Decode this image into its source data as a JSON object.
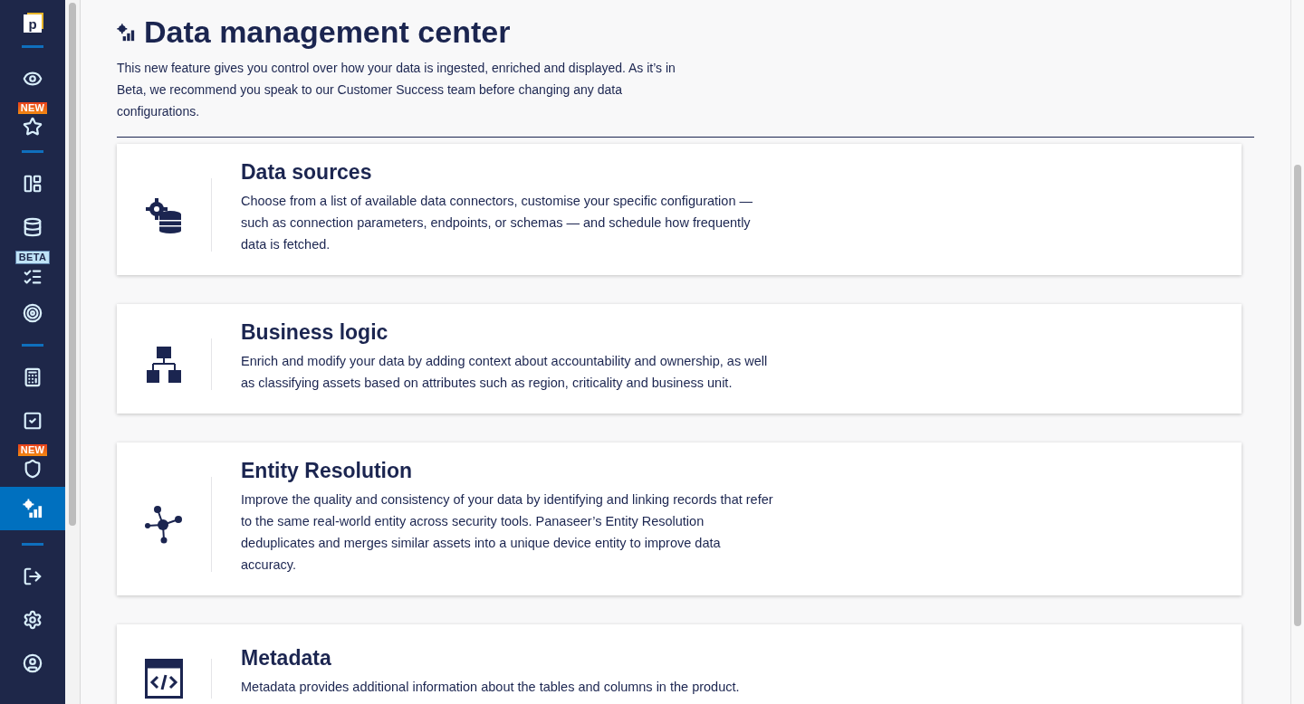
{
  "sidebar": {
    "items": [
      {
        "kind": "logo",
        "label": "p"
      },
      {
        "kind": "divider"
      },
      {
        "kind": "nav",
        "selected": false
      },
      {
        "kind": "nav",
        "selected": false,
        "badge": {
          "text": "NEW",
          "kind": "new"
        }
      },
      {
        "kind": "divider"
      },
      {
        "kind": "nav",
        "selected": false
      },
      {
        "kind": "nav",
        "selected": false
      },
      {
        "kind": "nav",
        "selected": false,
        "badge": {
          "text": "BETA",
          "kind": "beta"
        }
      },
      {
        "kind": "nav",
        "selected": false
      },
      {
        "kind": "divider"
      },
      {
        "kind": "nav",
        "selected": false
      },
      {
        "kind": "nav",
        "selected": false
      },
      {
        "kind": "nav",
        "selected": false,
        "badge": {
          "text": "NEW",
          "kind": "new"
        }
      },
      {
        "kind": "nav",
        "selected": true
      },
      {
        "kind": "divider"
      },
      {
        "kind": "nav",
        "selected": false
      },
      {
        "kind": "nav",
        "selected": false
      },
      {
        "kind": "nav",
        "selected": false
      }
    ]
  },
  "page": {
    "title": "Data management center",
    "intro": "This new feature gives you control over how your data is ingested, enriched and displayed. As it’s in Beta, we recommend you speak to our Customer Success team before changing any data configurations."
  },
  "cards": [
    {
      "title": "Data sources",
      "description": "Choose from a list of available data connectors, customise your specific configuration — such as connection parameters, endpoints, or schemas — and schedule how frequently data is fetched."
    },
    {
      "title": "Business logic",
      "description": "Enrich and modify your data by adding context about accountability and ownership, as well as classifying assets based on attributes such as region, criticality and business unit."
    },
    {
      "title": "Entity Resolution",
      "description": "Improve the quality and consistency of your data by identifying and linking records that refer to the same real-world entity across security tools. Panaseer’s Entity Resolution deduplicates and merges similar assets into a unique device entity to improve data accuracy."
    },
    {
      "title": "Metadata",
      "description": "Metadata provides additional information about the tables and columns in the product."
    }
  ]
}
